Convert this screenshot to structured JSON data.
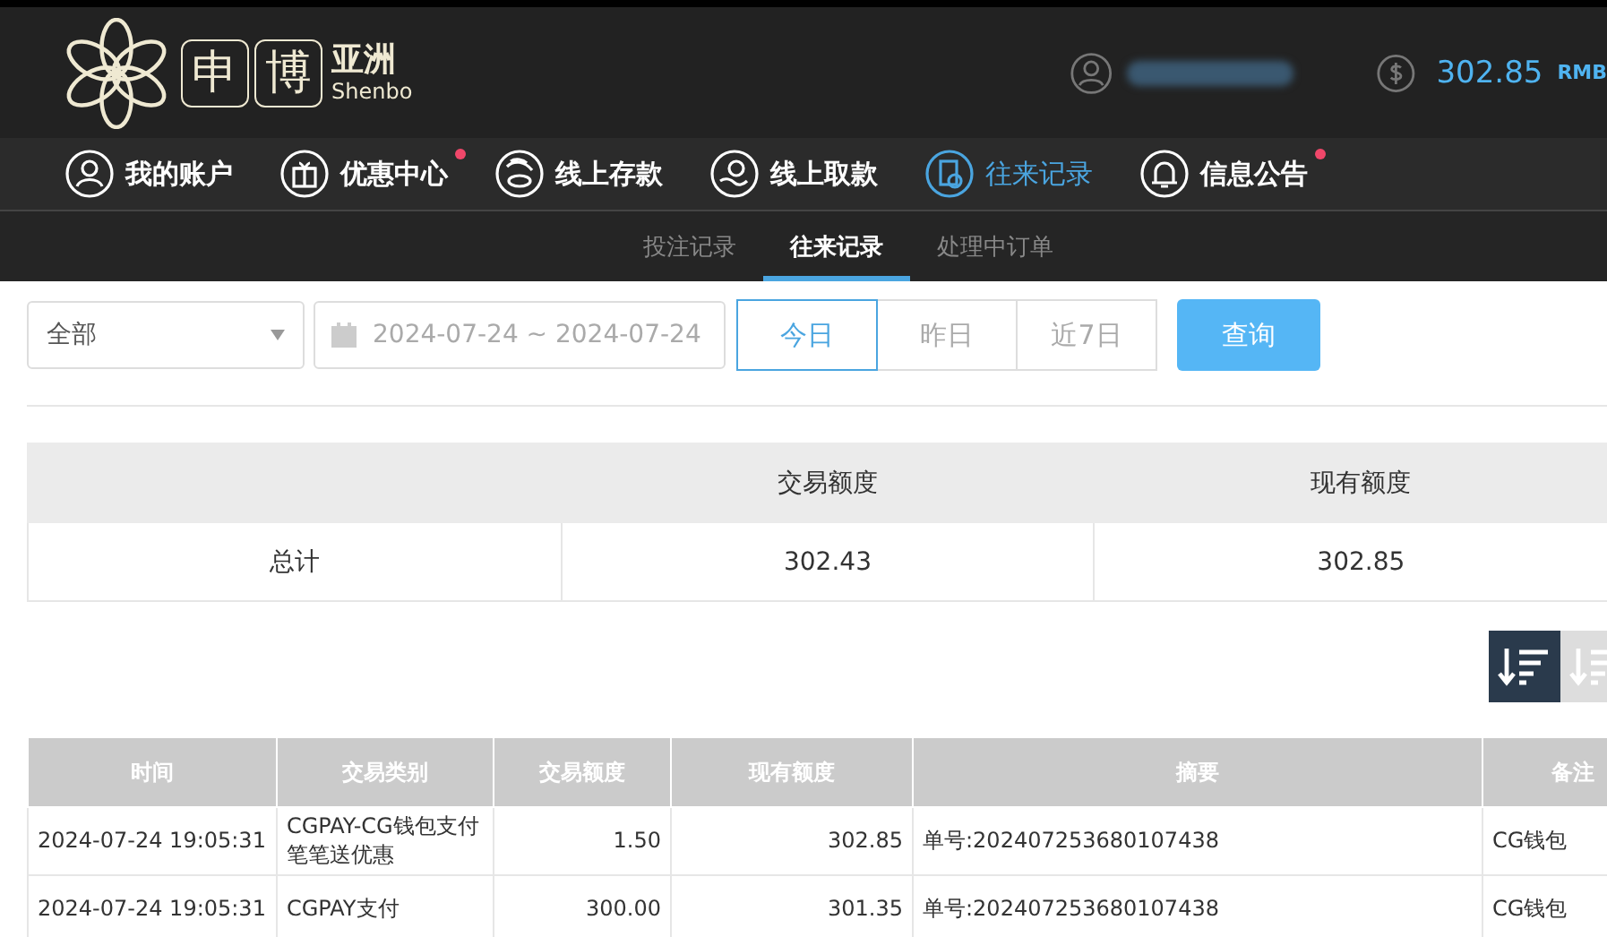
{
  "header": {
    "logo": {
      "box_chars": [
        "申",
        "博"
      ],
      "name_cn": "亚洲",
      "name_en": "Shenbo"
    },
    "balance": "302.85",
    "currency": "RMB"
  },
  "nav": [
    {
      "label": "我的账户",
      "kind": "user",
      "selected": false,
      "badge": false
    },
    {
      "label": "优惠中心",
      "kind": "gift",
      "selected": false,
      "badge": true
    },
    {
      "label": "线上存款",
      "kind": "deposit",
      "selected": false,
      "badge": false
    },
    {
      "label": "线上取款",
      "kind": "withdraw",
      "selected": false,
      "badge": false
    },
    {
      "label": "往来记录",
      "kind": "record",
      "selected": true,
      "badge": false
    },
    {
      "label": "信息公告",
      "kind": "bell",
      "selected": false,
      "badge": true
    }
  ],
  "subtabs": [
    {
      "label": "投注记录",
      "selected": false
    },
    {
      "label": "往来记录",
      "selected": true
    },
    {
      "label": "处理中订单",
      "selected": false
    }
  ],
  "filters": {
    "type_select": "全部",
    "date_range": "2024-07-24 ~ 2024-07-24",
    "quick_ranges": [
      {
        "label": "今日",
        "selected": true
      },
      {
        "label": "昨日",
        "selected": false
      },
      {
        "label": "近7日",
        "selected": false
      }
    ],
    "query_button": "查询"
  },
  "summary": {
    "columns": [
      "交易额度",
      "现有额度"
    ],
    "row": {
      "label": "总计",
      "values": [
        "302.43",
        "302.85"
      ]
    }
  },
  "sort_buttons": [
    {
      "selected": true
    },
    {
      "selected": false
    }
  ],
  "table": {
    "columns": [
      "时间",
      "交易类别",
      "交易额度",
      "现有额度",
      "摘要",
      "备注"
    ],
    "rows": [
      [
        "2024-07-24 19:05:31",
        "CGPAY-CG钱包支付笔笔送优惠",
        "1.50",
        "302.85",
        "单号:202407253680107438",
        "CG钱包"
      ],
      [
        "2024-07-24 19:05:31",
        "CGPAY支付",
        "300.00",
        "301.35",
        "单号:202407253680107438",
        "CG钱包"
      ]
    ]
  }
}
